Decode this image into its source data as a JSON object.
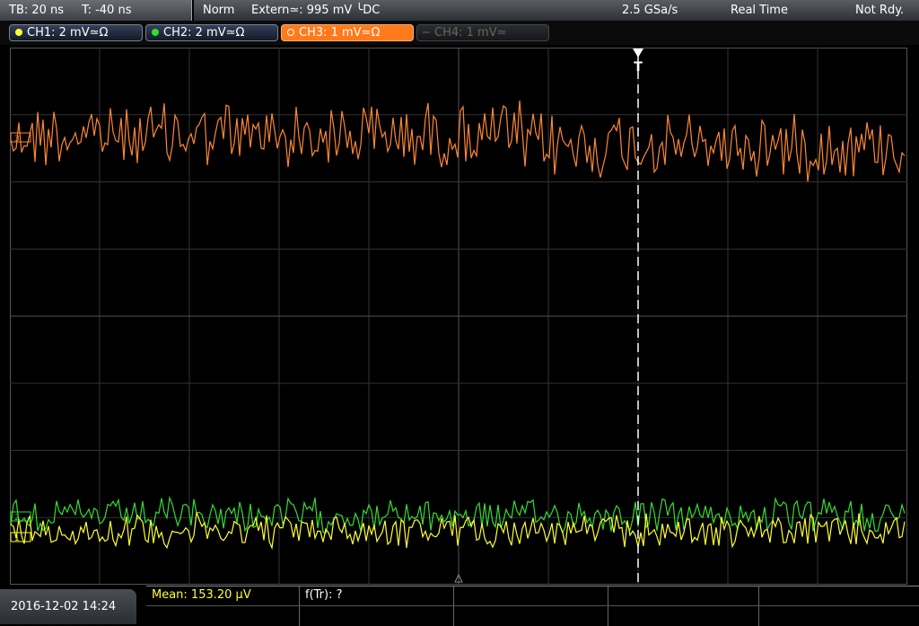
{
  "top": {
    "timebase": "TB: 20 ns",
    "trigger_time": "T: -40 ns",
    "trigger_mode": "Norm",
    "trigger_source": "Extern≃: 995 mV ╰DC",
    "sample_rate": "2.5 GSa/s",
    "acq_mode": "Real Time",
    "status": "Not Rdy."
  },
  "channels": [
    {
      "label": "CH1: 2 mV≃Ω",
      "color": "#ffff33",
      "active": false,
      "enabled": true
    },
    {
      "label": "CH2: 2 mV≃Ω",
      "color": "#33dd33",
      "active": false,
      "enabled": true
    },
    {
      "label": "CH3: 1 mV≃Ω",
      "color": "#ff8833",
      "active": true,
      "enabled": true
    },
    {
      "label": "CH4: 1 mV≃",
      "color": "#555555",
      "active": false,
      "enabled": false
    }
  ],
  "markers": {
    "trigger": "T",
    "ch1": "1",
    "ch2": "2",
    "ch3": "3"
  },
  "bottom": {
    "datetime": "2016-12-02 14:24",
    "measurement_1": "Mean: 153.20 µV",
    "measurement_2": "f(Tr): ?"
  },
  "colors": {
    "ch1": "#ffff33",
    "ch2": "#33dd33",
    "ch3": "#ff8833",
    "grid": "#333333"
  }
}
